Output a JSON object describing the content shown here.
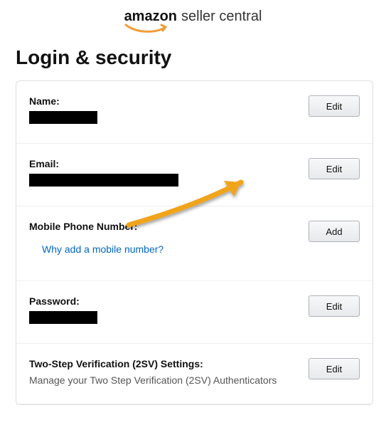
{
  "logo": {
    "brand": "amazon",
    "suffix": "seller central"
  },
  "page": {
    "title": "Login & security"
  },
  "rows": {
    "name": {
      "label": "Name:",
      "button": "Edit"
    },
    "email": {
      "label": "Email:",
      "button": "Edit"
    },
    "phone": {
      "label": "Mobile Phone Number:",
      "button": "Add",
      "link": "Why add a mobile number?"
    },
    "password": {
      "label": "Password:",
      "button": "Edit"
    },
    "twosv": {
      "label": "Two-Step Verification (2SV) Settings:",
      "subtext": "Manage your Two Step Verification (2SV) Authenticators",
      "button": "Edit"
    }
  },
  "annotation": {
    "arrow_color": "#f0a41e"
  }
}
